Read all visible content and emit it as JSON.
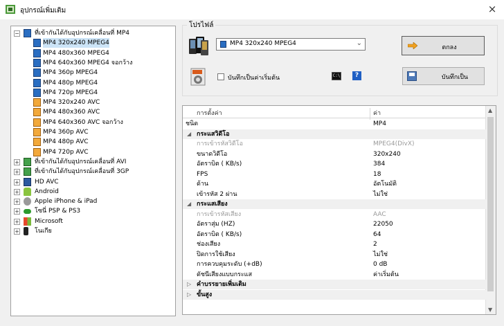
{
  "window": {
    "title": "อุปกรณ์เพิ่มเติม",
    "close_icon": "×"
  },
  "tree": {
    "root": {
      "label": "ที่เข้ากันได้กับอุปกรณ์เคลื่อนที่ MP4",
      "expander": "−",
      "children": [
        {
          "label": "MP4 320x240 MPEG4",
          "icon": "mp4"
        },
        {
          "label": "MP4 480x360 MPEG4",
          "icon": "mp4"
        },
        {
          "label": "MP4 640x360 MPEG4  จอกว้าง",
          "icon": "mp4"
        },
        {
          "label": "MP4 360p MPEG4",
          "icon": "mp4"
        },
        {
          "label": "MP4 480p MPEG4",
          "icon": "mp4"
        },
        {
          "label": "MP4 720p MPEG4",
          "icon": "mp4"
        },
        {
          "label": "MP4 320x240 AVC",
          "icon": "avc"
        },
        {
          "label": "MP4 480x360 AVC",
          "icon": "avc"
        },
        {
          "label": "MP4 640x360 AVC  จอกว้าง",
          "icon": "avc"
        },
        {
          "label": "MP4 360p AVC",
          "icon": "avc"
        },
        {
          "label": "MP4 480p AVC",
          "icon": "avc"
        },
        {
          "label": "MP4 720p AVC",
          "icon": "avc"
        }
      ]
    },
    "others": [
      {
        "label": "ที่เข้ากันได้กับอุปกรณ์เคลื่อนที่ AVI",
        "icon": "avi",
        "expander": "+"
      },
      {
        "label": "ที่เข้ากันได้กับอุปกรณ์เคลื่อนที่ 3GP",
        "icon": "avi",
        "expander": "+"
      },
      {
        "label": "HD AVC",
        "icon": "hd",
        "expander": "+"
      },
      {
        "label": "Android",
        "icon": "android",
        "expander": "+"
      },
      {
        "label": "Apple iPhone & iPad",
        "icon": "apple",
        "expander": "+"
      },
      {
        "label": "โซนี่ PSP & PS3",
        "icon": "sony",
        "expander": "+"
      },
      {
        "label": "Microsoft",
        "icon": "ms",
        "expander": "+"
      },
      {
        "label": "โนเกีย",
        "icon": "nokia",
        "expander": "+"
      }
    ]
  },
  "profile": {
    "group_label": "โปรไฟล์",
    "selected": "MP4 320x240 MPEG4",
    "dropdown_arrow": "⌄",
    "ok_label": "ตกลง",
    "save_default_label": "บันทึกเป็นค่าเริ่มต้น",
    "save_default_checked": false,
    "cmd_icon_text": "C:\\",
    "help_icon_text": "?",
    "save_as_label": "บันทึกเป็น"
  },
  "properties": {
    "header": {
      "setting": "การตั้งค่า",
      "value": "ค่า"
    },
    "rows": [
      {
        "key": "ชนิด",
        "value": "MP4",
        "kind": "top"
      },
      {
        "key": "กระแสวิดีโอ",
        "value": "",
        "kind": "cat",
        "toggle": "◢"
      },
      {
        "key": "การเข้ารหัสวิดีโอ",
        "value": "MPEG4(DivX)",
        "kind": "dis"
      },
      {
        "key": "ขนาดวิดีโอ",
        "value": "320x240",
        "kind": "prop"
      },
      {
        "key": "อัตราบิต ( KB/s)",
        "value": "384",
        "kind": "prop"
      },
      {
        "key": "FPS",
        "value": "18",
        "kind": "prop"
      },
      {
        "key": "ด้าน",
        "value": "อัตโนมัติ",
        "kind": "prop"
      },
      {
        "key": "เข้ารหัส 2 ผ่าน",
        "value": "ไม่ใช่",
        "kind": "prop"
      },
      {
        "key": "กระแสเสียง",
        "value": "",
        "kind": "cat",
        "toggle": "◢"
      },
      {
        "key": "การเข้ารหัสเสียง",
        "value": "AAC",
        "kind": "dis"
      },
      {
        "key": "อัตราสุ่ม (HZ)",
        "value": "22050",
        "kind": "prop"
      },
      {
        "key": "อัตราบิต ( KB/s)",
        "value": "64",
        "kind": "prop"
      },
      {
        "key": "ช่องเสียง",
        "value": "2",
        "kind": "prop"
      },
      {
        "key": "ปิดการใช้เสียง",
        "value": "ไม่ใช่",
        "kind": "prop"
      },
      {
        "key": "การควบคุมระดับ (+dB)",
        "value": "0 dB",
        "kind": "prop"
      },
      {
        "key": "ดัชนีเสียงแบบกระแส",
        "value": "ค่าเริ่มต้น",
        "kind": "prop"
      },
      {
        "key": "คำบรรยายเพิ่มเติม",
        "value": "",
        "kind": "cat",
        "toggle": "▷"
      },
      {
        "key": "ขั้นสูง",
        "value": "",
        "kind": "cat",
        "toggle": "▷"
      }
    ],
    "scroll_up": "▲",
    "scroll_down": "▼"
  }
}
